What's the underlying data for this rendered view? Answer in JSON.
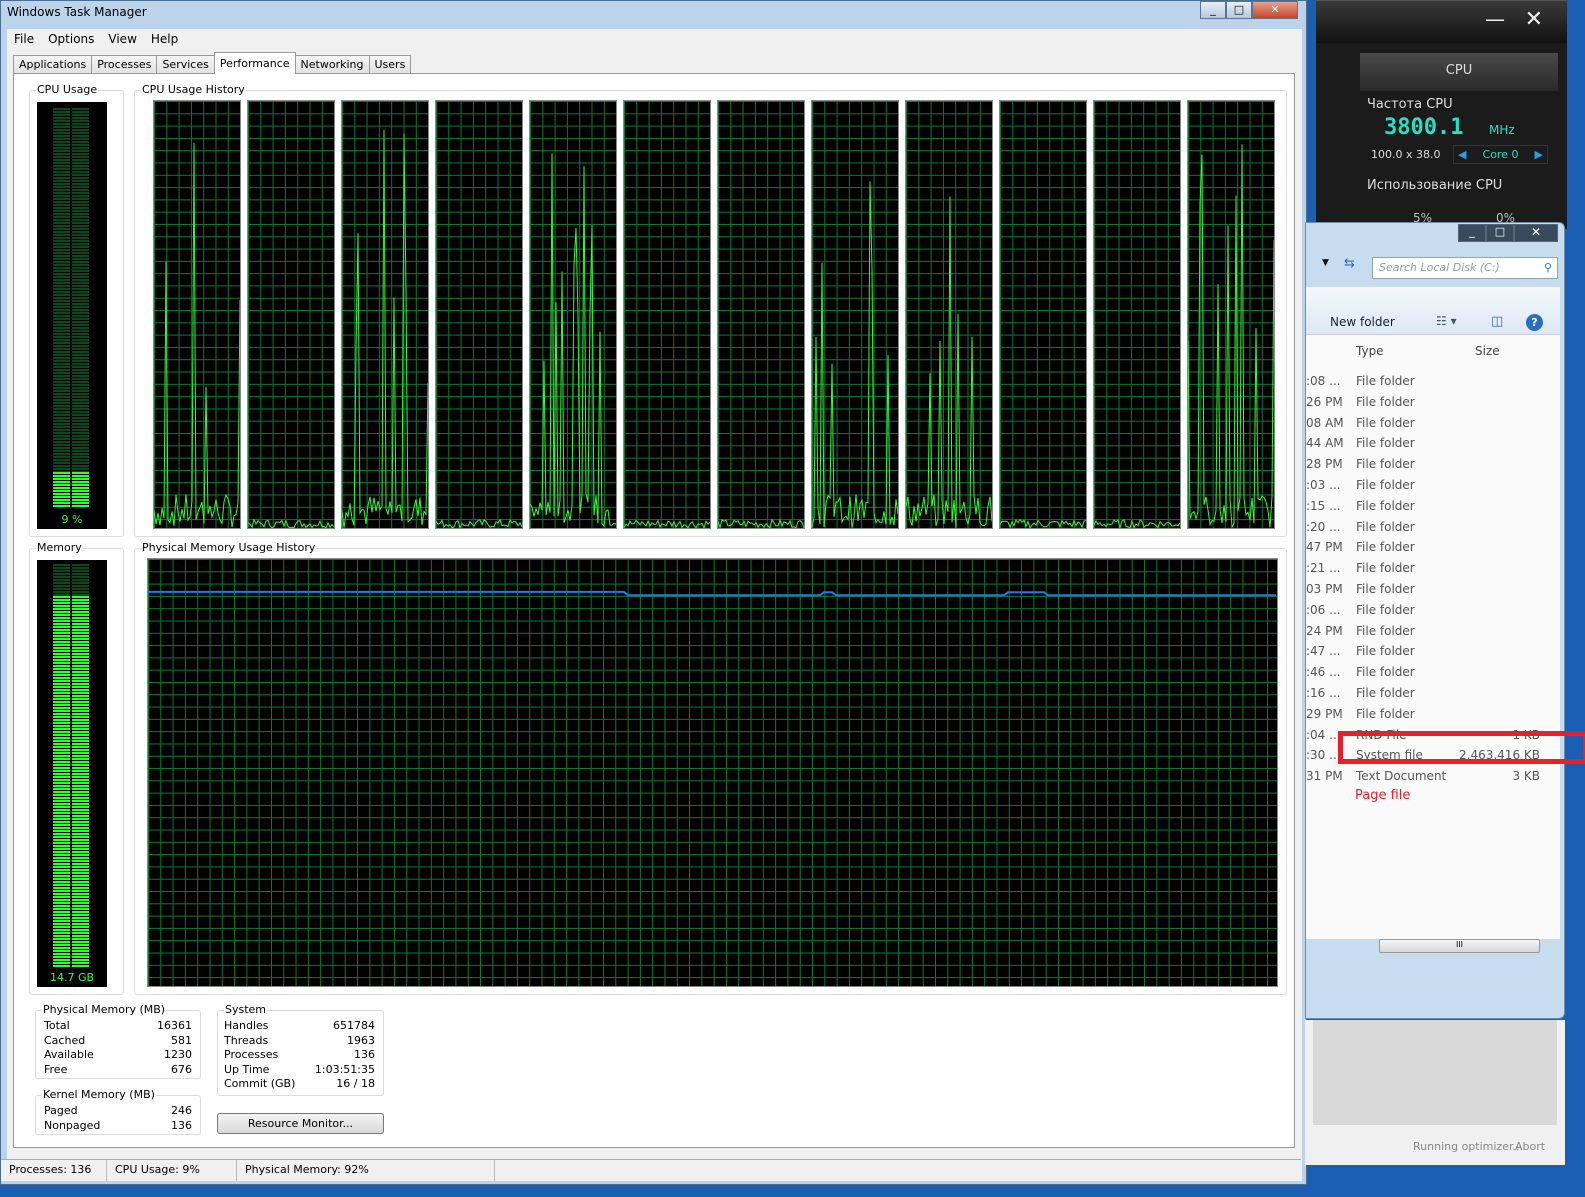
{
  "taskmanager": {
    "title": "Windows Task Manager",
    "menu": [
      "File",
      "Options",
      "View",
      "Help"
    ],
    "tabs": [
      "Applications",
      "Processes",
      "Services",
      "Performance",
      "Networking",
      "Users"
    ],
    "active_tab": "Performance",
    "cpu_usage_label": "CPU Usage",
    "cpu_usage_value": "9 %",
    "cpu_history_label": "CPU Usage History",
    "memory_label": "Memory",
    "memory_value": "14.7 GB",
    "memory_history_label": "Physical Memory Usage History",
    "physical_memory": {
      "title": "Physical Memory (MB)",
      "rows": [
        [
          "Total",
          "16361"
        ],
        [
          "Cached",
          "581"
        ],
        [
          "Available",
          "1230"
        ],
        [
          "Free",
          "676"
        ]
      ]
    },
    "kernel_memory": {
      "title": "Kernel Memory (MB)",
      "rows": [
        [
          "Paged",
          "246"
        ],
        [
          "Nonpaged",
          "136"
        ]
      ]
    },
    "system": {
      "title": "System",
      "rows": [
        [
          "Handles",
          "651784"
        ],
        [
          "Threads",
          "1963"
        ],
        [
          "Processes",
          "136"
        ],
        [
          "Up Time",
          "1:03:51:35"
        ],
        [
          "Commit (GB)",
          "16 / 18"
        ]
      ]
    },
    "resource_monitor_label": "Resource Monitor...",
    "status": [
      "Processes: 136",
      "CPU Usage: 9%",
      "Physical Memory: 92%"
    ]
  },
  "chart_data": {
    "type": "line",
    "cores": 12,
    "cpu_usage_percent": 9,
    "memory_usage_percent": 92,
    "memory_history_percent_approx": [
      92,
      92,
      92,
      91,
      91,
      91
    ]
  },
  "gadget": {
    "tab": "CPU",
    "freq_label": "Частота CPU",
    "freq": "3800.1",
    "unit": "MHz",
    "multiplier": "100.0 x 38.0",
    "core": "Core 0",
    "usage_label": "Использование CPU",
    "usage": [
      "5%",
      "0%"
    ]
  },
  "explorer": {
    "search_placeholder": "Search Local Disk (C:)",
    "new_folder": "New folder",
    "col_type": "Type",
    "col_size": "Size",
    "rows": [
      [
        ":08 ...",
        "File folder",
        ""
      ],
      [
        "26 PM",
        "File folder",
        ""
      ],
      [
        "08 AM",
        "File folder",
        ""
      ],
      [
        "44 AM",
        "File folder",
        ""
      ],
      [
        "28 PM",
        "File folder",
        ""
      ],
      [
        ":03 ...",
        "File folder",
        ""
      ],
      [
        ":15 ...",
        "File folder",
        ""
      ],
      [
        ":20 ...",
        "File folder",
        ""
      ],
      [
        "47 PM",
        "File folder",
        ""
      ],
      [
        ":21 ...",
        "File folder",
        ""
      ],
      [
        "03 PM",
        "File folder",
        ""
      ],
      [
        ":06 ...",
        "File folder",
        ""
      ],
      [
        "24 PM",
        "File folder",
        ""
      ],
      [
        ":47 ...",
        "File folder",
        ""
      ],
      [
        ":46 ...",
        "File folder",
        ""
      ],
      [
        ":16 ...",
        "File folder",
        ""
      ],
      [
        "29 PM",
        "File folder",
        ""
      ],
      [
        ":04 ...",
        "RND File",
        "1 KB"
      ],
      [
        ":30 ...",
        "System file",
        "2,463,416 KB"
      ],
      [
        "31 PM",
        "Text Document",
        "3 KB"
      ]
    ],
    "annotation": "Page file",
    "status": "Running optimizer...",
    "abort": "Abort"
  },
  "colors": {
    "graph_green": "#2eff2e",
    "grid": "#0a7a3a",
    "memory_line": "#1e7fe0",
    "highlight": "#e8202a"
  }
}
